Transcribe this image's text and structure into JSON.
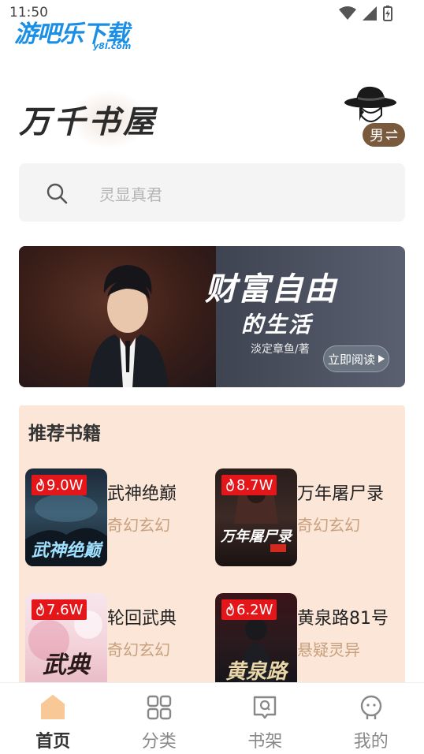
{
  "status_bar": {
    "time": "11:50",
    "watermark": "游吧乐下载",
    "watermark_sub": "y8l.com"
  },
  "header": {
    "logo_text": "万千书屋",
    "gender_toggle": "男"
  },
  "search": {
    "placeholder": "灵显真君"
  },
  "banner": {
    "title_line1": "财富自由",
    "title_line2": "的生活",
    "author": "淡定章鱼/著",
    "read_button": "立即阅读"
  },
  "recommended": {
    "title": "推荐书籍",
    "books": [
      {
        "name": "武神绝巅",
        "genre": "奇幻玄幻",
        "heat": "9.0W",
        "cover_title": "武神绝巅"
      },
      {
        "name": "万年屠尸录",
        "genre": "奇幻玄幻",
        "heat": "8.7W",
        "cover_title": "万年屠尸录"
      },
      {
        "name": "轮回武典",
        "genre": "奇幻玄幻",
        "heat": "7.6W",
        "cover_title": "武典"
      },
      {
        "name": "黄泉路81号",
        "genre": "悬疑灵异",
        "heat": "6.2W",
        "cover_title": "黄泉路"
      }
    ]
  },
  "bottom_nav": {
    "items": [
      {
        "label": "首页",
        "icon": "home-icon",
        "active": true
      },
      {
        "label": "分类",
        "icon": "category-icon",
        "active": false
      },
      {
        "label": "书架",
        "icon": "bookshelf-icon",
        "active": false
      },
      {
        "label": "我的",
        "icon": "profile-icon",
        "active": false
      }
    ]
  },
  "colors": {
    "accent_heat": "#e4161a",
    "genre_text": "#c8a07e",
    "recommended_bg": "#fbe6d8",
    "gender_badge": "#7a5a3c"
  }
}
